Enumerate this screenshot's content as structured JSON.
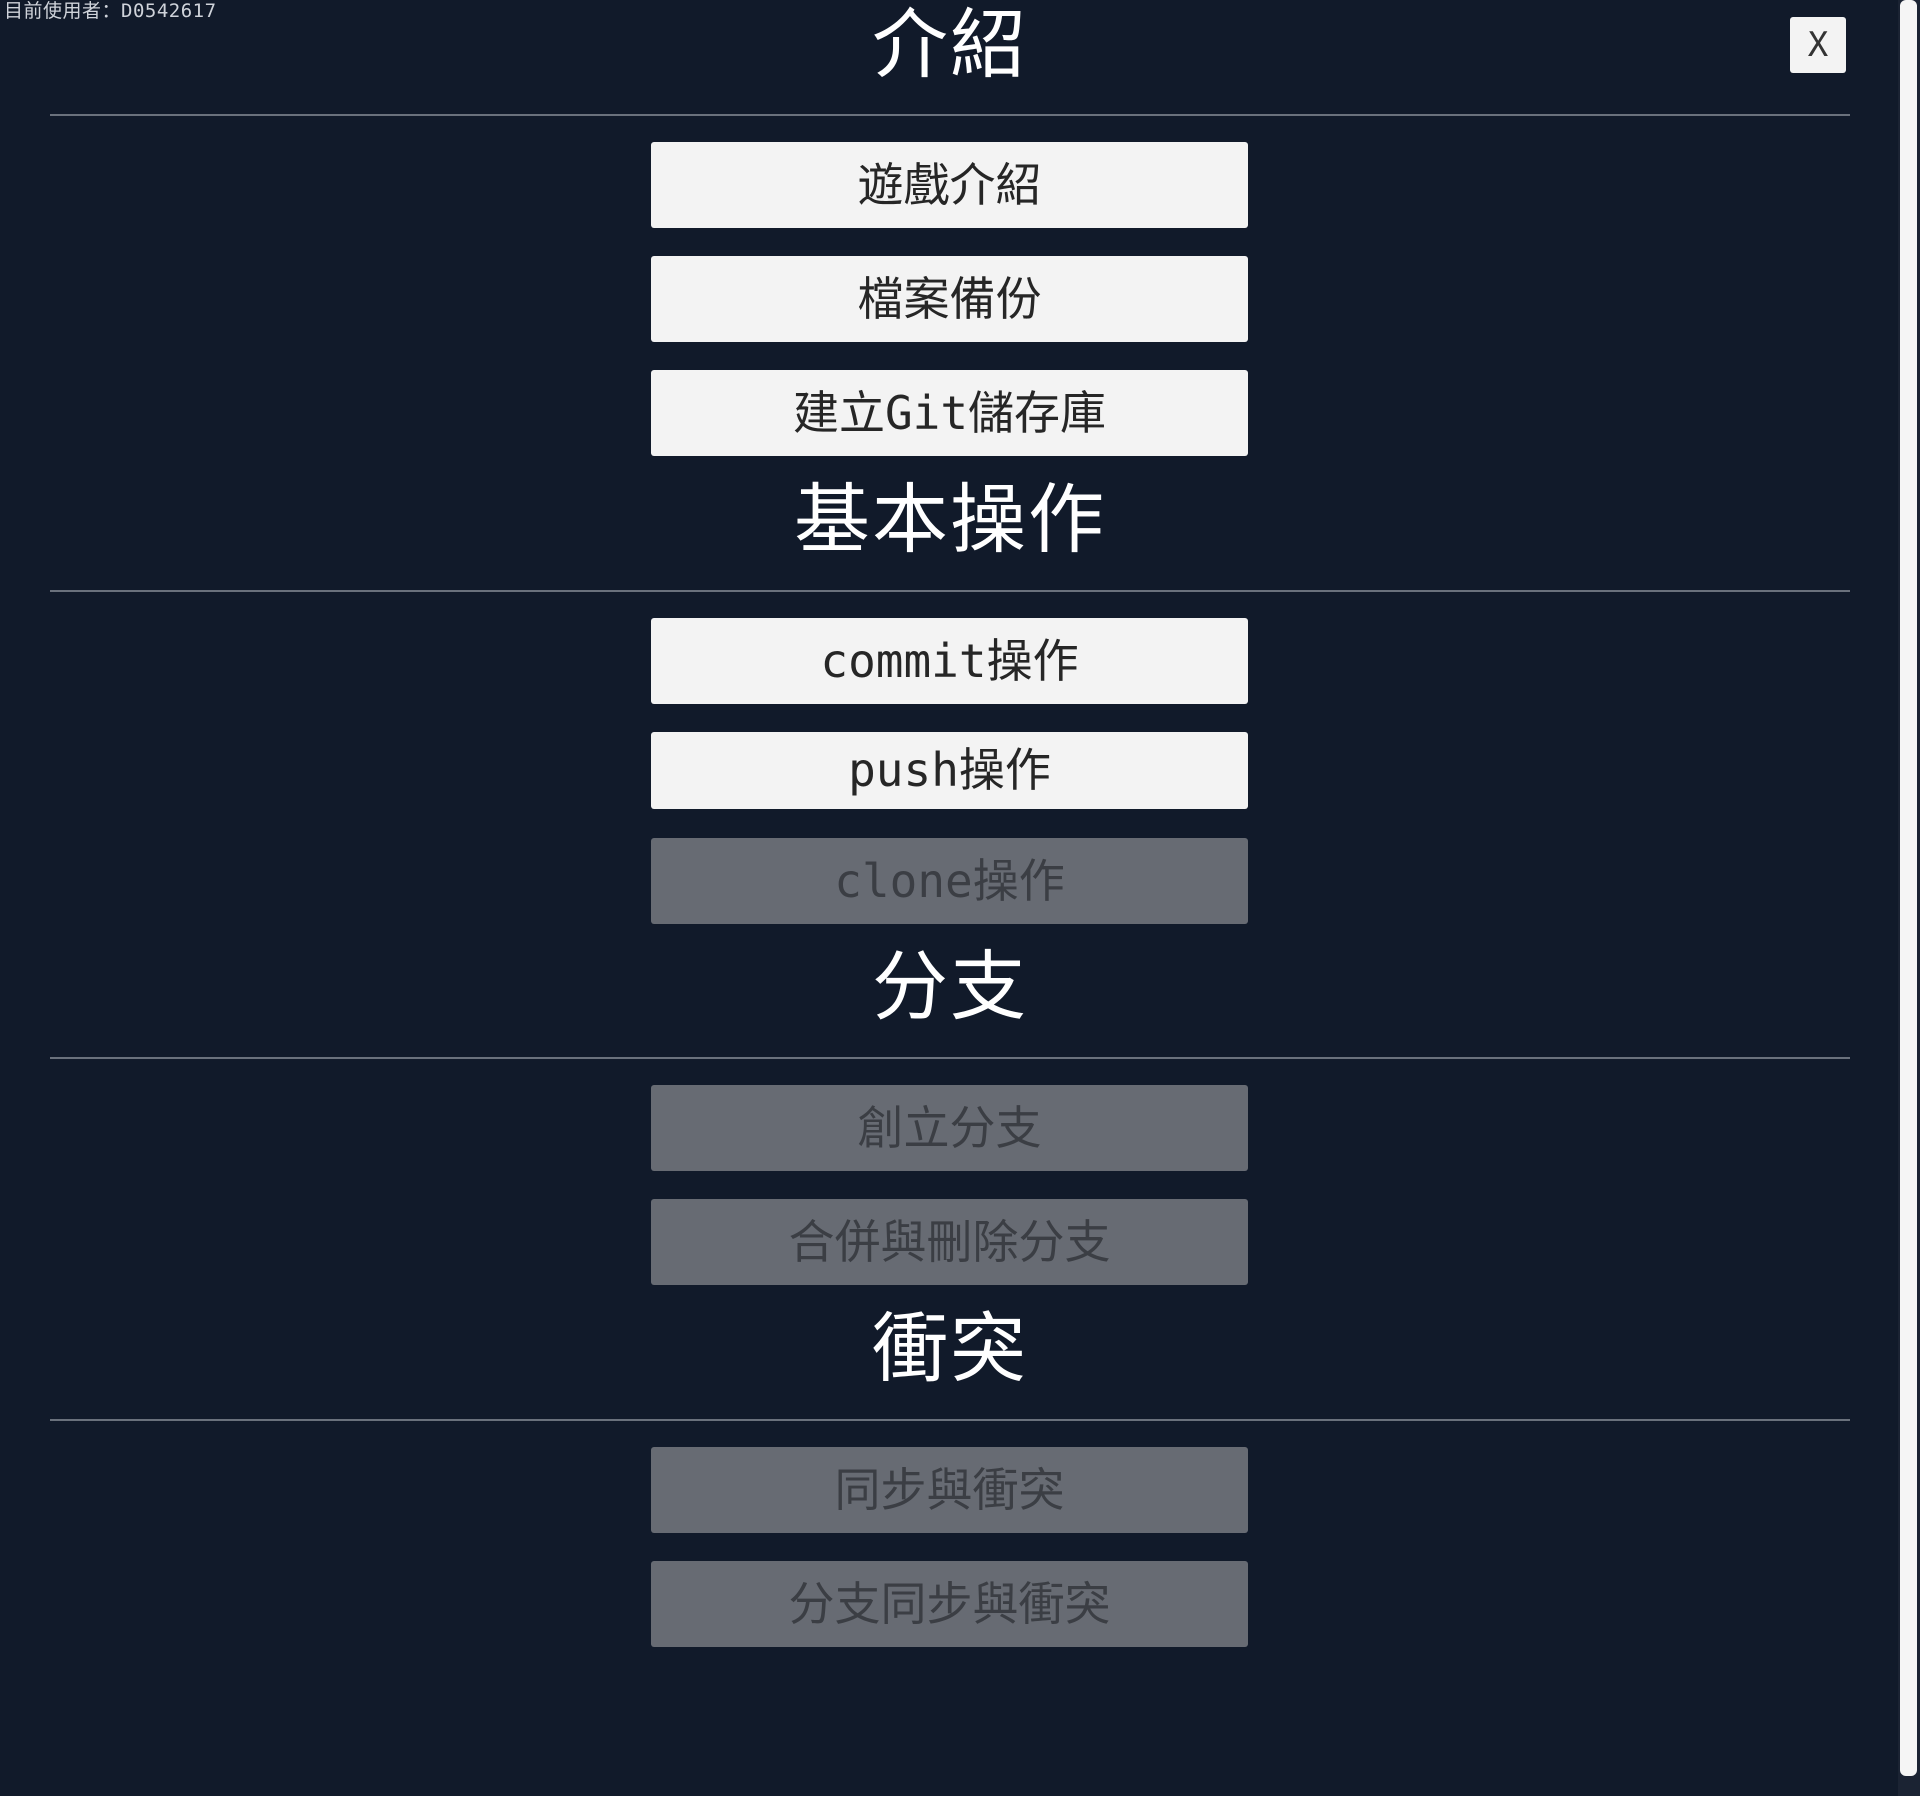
{
  "current_user": "目前使用者：D0542617",
  "close_label": "X",
  "sections": [
    {
      "title": "介紹",
      "items": [
        {
          "label": "遊戲介紹",
          "enabled": true
        },
        {
          "label": "檔案備份",
          "enabled": true
        },
        {
          "label": "建立Git儲存庫",
          "enabled": true
        }
      ]
    },
    {
      "title": "基本操作",
      "items": [
        {
          "label": "commit操作",
          "enabled": true
        },
        {
          "label": "push操作",
          "enabled": true
        },
        {
          "label": "clone操作",
          "enabled": false
        }
      ]
    },
    {
      "title": "分支",
      "items": [
        {
          "label": "創立分支",
          "enabled": false
        },
        {
          "label": "合併與刪除分支",
          "enabled": false
        }
      ]
    },
    {
      "title": "衝突",
      "items": [
        {
          "label": "同步與衝突",
          "enabled": false
        },
        {
          "label": "分支同步與衝突",
          "enabled": false
        }
      ]
    }
  ],
  "colors": {
    "background": "#111a2a",
    "button_enabled": "#f3f3f3",
    "button_disabled": "#676b73"
  }
}
